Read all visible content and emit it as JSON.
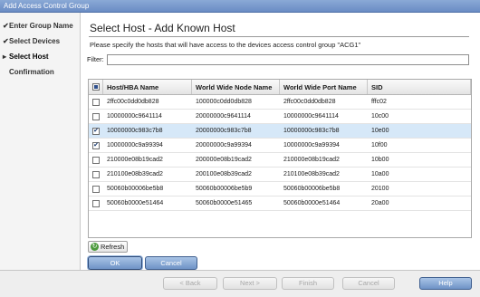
{
  "window": {
    "title": "Add Access Control Group"
  },
  "steps": [
    {
      "label": "Enter Group Name",
      "mark": "✔",
      "state": "done"
    },
    {
      "label": "Select Devices",
      "mark": "✔",
      "state": "done"
    },
    {
      "label": "Select Host",
      "mark": "▸",
      "state": "current"
    },
    {
      "label": "Confirmation",
      "mark": "",
      "state": "pending"
    }
  ],
  "main": {
    "title": "Select Host - Add Known Host",
    "instructions": "Please specify the hosts that will have access to the devices access control group \"ACG1\"",
    "filter_label": "Filter:",
    "filter_value": ""
  },
  "table": {
    "columns": [
      "Host/HBA Name",
      "World Wide Node Name",
      "World Wide Port Name",
      "SID"
    ],
    "rows": [
      {
        "checked": false,
        "selected": false,
        "cells": [
          "2ffc00c0dd0db828",
          "100000c0dd0db828",
          "2ffc00c0dd0db828",
          "fffc02"
        ]
      },
      {
        "checked": false,
        "selected": false,
        "cells": [
          "10000000c9641114",
          "20000000c9641114",
          "10000000c9641114",
          "10c00"
        ]
      },
      {
        "checked": true,
        "selected": true,
        "cells": [
          "10000000c983c7b8",
          "20000000c983c7b8",
          "10000000c983c7b8",
          "10e00"
        ]
      },
      {
        "checked": true,
        "selected": false,
        "cells": [
          "10000000c9a99394",
          "20000000c9a99394",
          "10000000c9a99394",
          "10f00"
        ]
      },
      {
        "checked": false,
        "selected": false,
        "cells": [
          "210000e08b19cad2",
          "200000e08b19cad2",
          "210000e08b19cad2",
          "10b00"
        ]
      },
      {
        "checked": false,
        "selected": false,
        "cells": [
          "210100e08b39cad2",
          "200100e08b39cad2",
          "210100e08b39cad2",
          "10a00"
        ]
      },
      {
        "checked": false,
        "selected": false,
        "cells": [
          "50060b00006be5b8",
          "50060b00006be5b9",
          "50060b00006be5b8",
          "20100"
        ]
      },
      {
        "checked": false,
        "selected": false,
        "cells": [
          "50060b0000e51464",
          "50060b0000e51465",
          "50060b0000e51464",
          "20a00"
        ]
      }
    ]
  },
  "buttons": {
    "refresh": "Refresh",
    "ok": "OK",
    "cancel": "Cancel",
    "back": "< Back",
    "next": "Next >",
    "finish": "Finish",
    "footer_cancel": "Cancel",
    "help": "Help"
  },
  "icons": {
    "refresh": "refresh-icon",
    "check": "checkmark-icon",
    "current_step": "arrow-right-icon"
  },
  "colors": {
    "selected_row": "#d6e8f8",
    "primary_button": "#6f93c6",
    "titlebar": "#6a8cc4"
  }
}
